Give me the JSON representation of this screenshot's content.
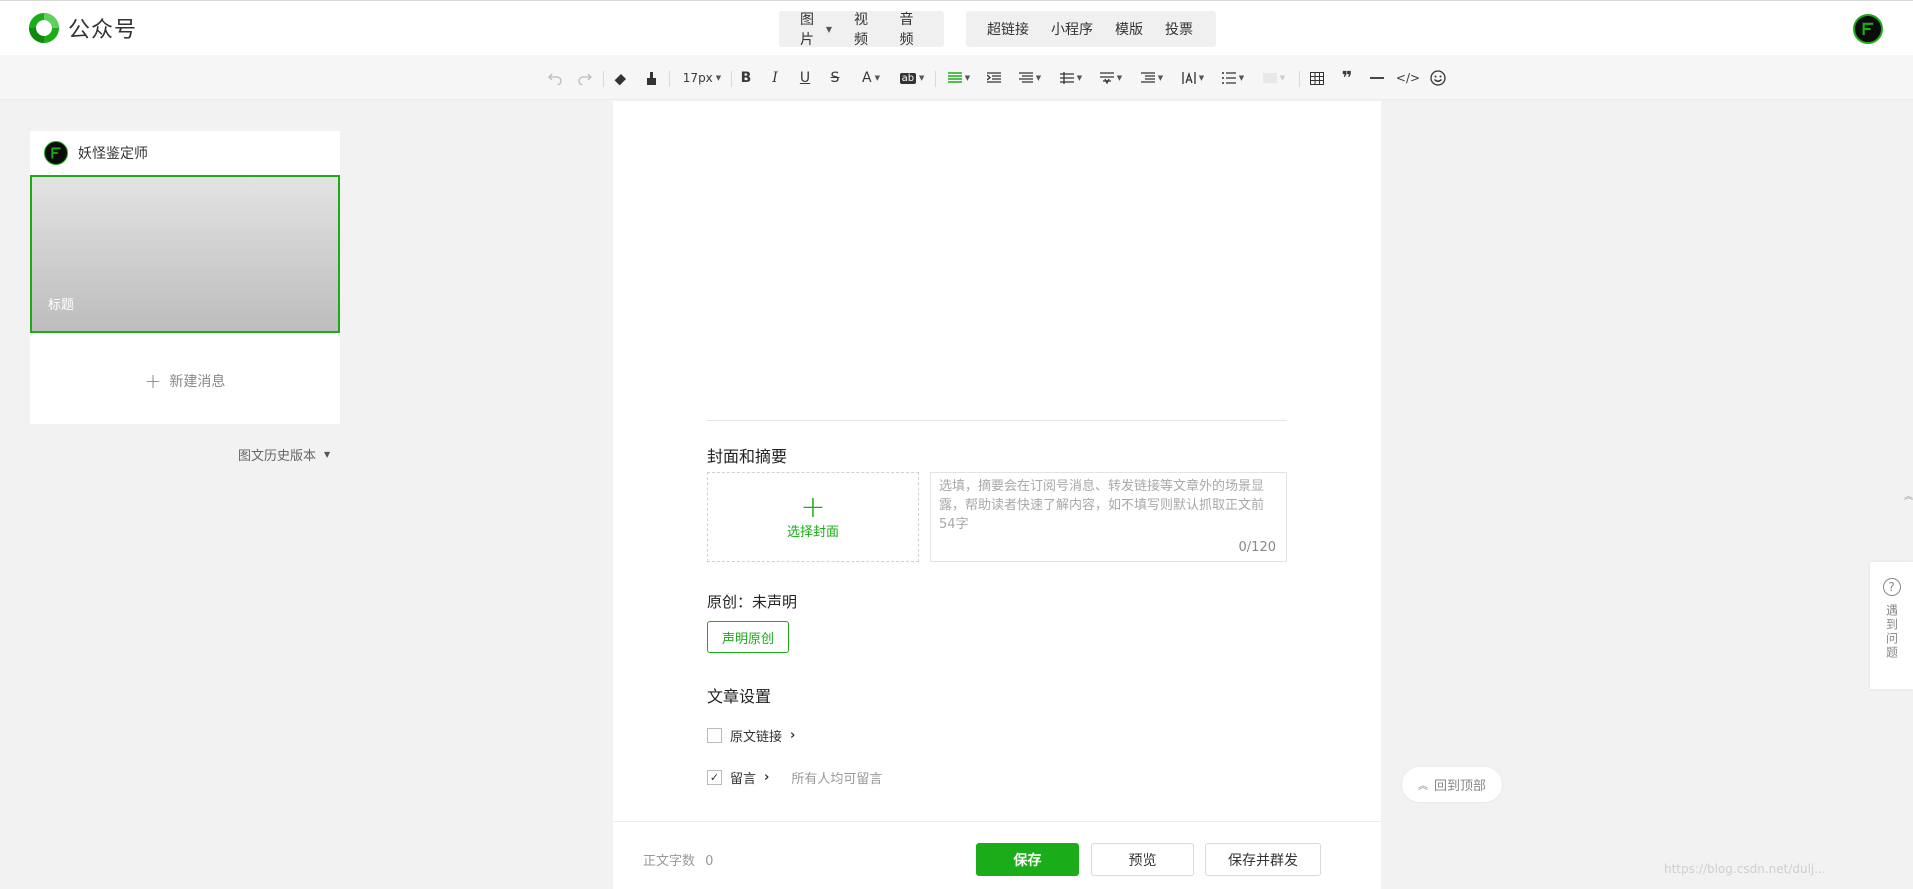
{
  "brand": {
    "name": "公众号",
    "color": "#1aad19"
  },
  "header": {
    "insert_left": [
      "图片",
      "视频",
      "音频"
    ],
    "insert_right": [
      "超链接",
      "小程序",
      "模版",
      "投票"
    ]
  },
  "toolbar": {
    "font_size": "17px"
  },
  "sidebar": {
    "account_name": "妖怪鉴定师",
    "cover_title": "标题",
    "new_message": "新建消息",
    "history": "图文历史版本"
  },
  "editor": {
    "cover_section_title": "封面和摘要",
    "choose_cover": "选择封面",
    "summary_placeholder": "选填，摘要会在订阅号消息、转发链接等文章外的场景显露，帮助读者快速了解内容，如不填写则默认抓取正文前54字",
    "summary_counter": "0/120",
    "original_label": "原创：未声明",
    "declare_original": "声明原创",
    "article_settings": "文章设置",
    "source_link": "原文链接",
    "source_link_checked": false,
    "comments": "留言",
    "comments_checked": true,
    "comments_scope": "所有人均可留言"
  },
  "footer": {
    "word_count_label": "正文字数",
    "word_count": "0",
    "save": "保存",
    "preview": "预览",
    "save_send": "保存并群发"
  },
  "floating": {
    "back_to_top": "回到顶部",
    "help": "遇到问题"
  },
  "watermark": "https://blog.csdn.net/dulj..."
}
